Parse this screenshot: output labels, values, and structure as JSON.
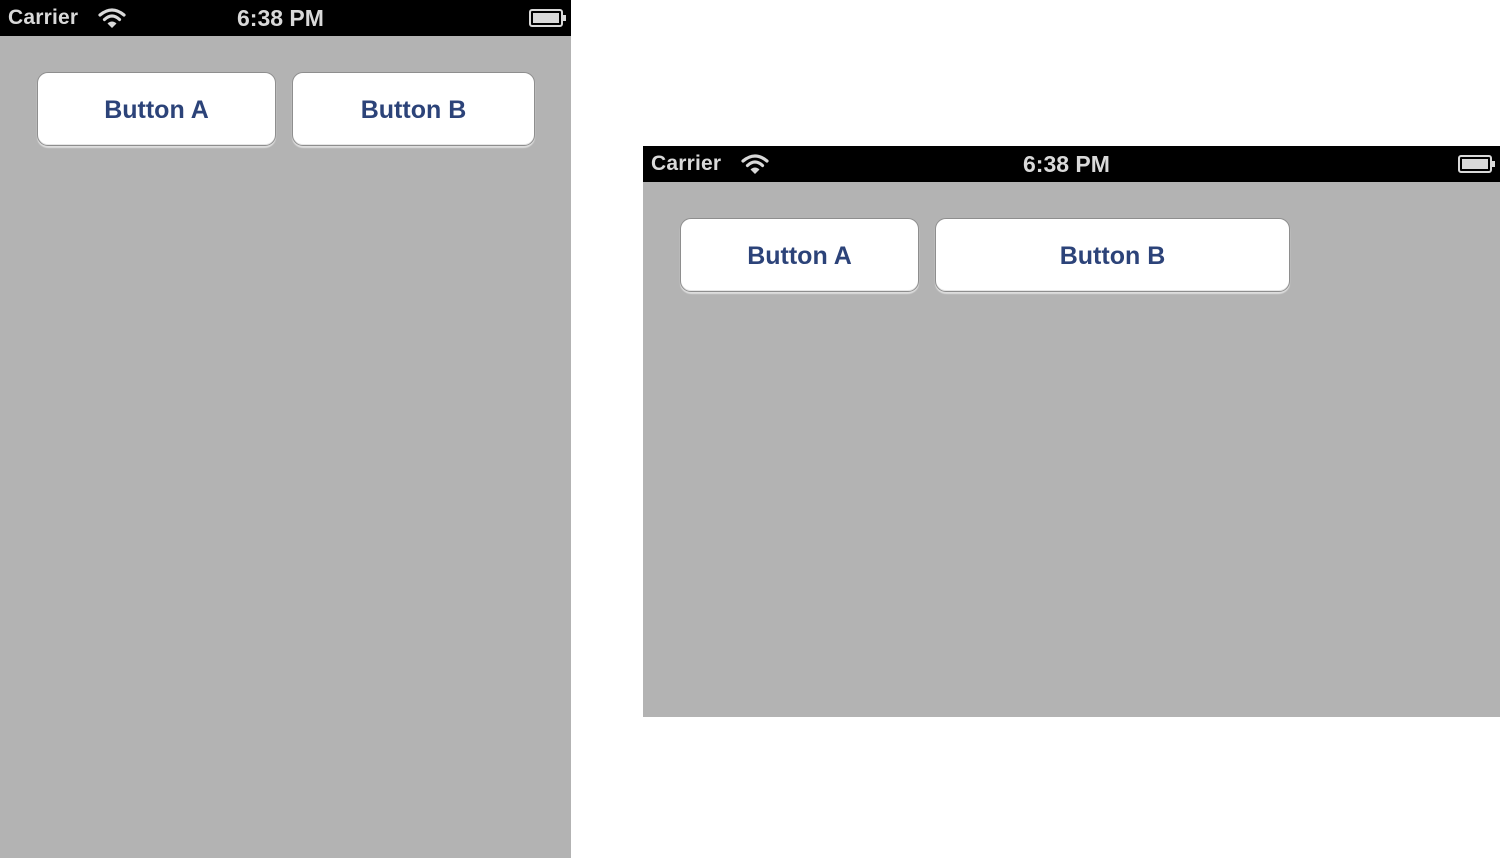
{
  "screens": [
    {
      "orientation": "portrait",
      "status_bar": {
        "carrier": "Carrier",
        "wifi_icon": "wifi-icon",
        "time": "6:38 PM",
        "battery_icon": "battery-icon"
      },
      "buttons": [
        {
          "label": "Button A"
        },
        {
          "label": "Button B"
        }
      ]
    },
    {
      "orientation": "landscape",
      "status_bar": {
        "carrier": "Carrier",
        "wifi_icon": "wifi-icon",
        "time": "6:38 PM",
        "battery_icon": "battery-icon"
      },
      "buttons": [
        {
          "label": "Button A"
        },
        {
          "label": "Button B"
        }
      ]
    }
  ],
  "colors": {
    "background": "#b3b3b3",
    "status_bar": "#000000",
    "button_fill": "#ffffff",
    "button_text": "#2c4379"
  }
}
